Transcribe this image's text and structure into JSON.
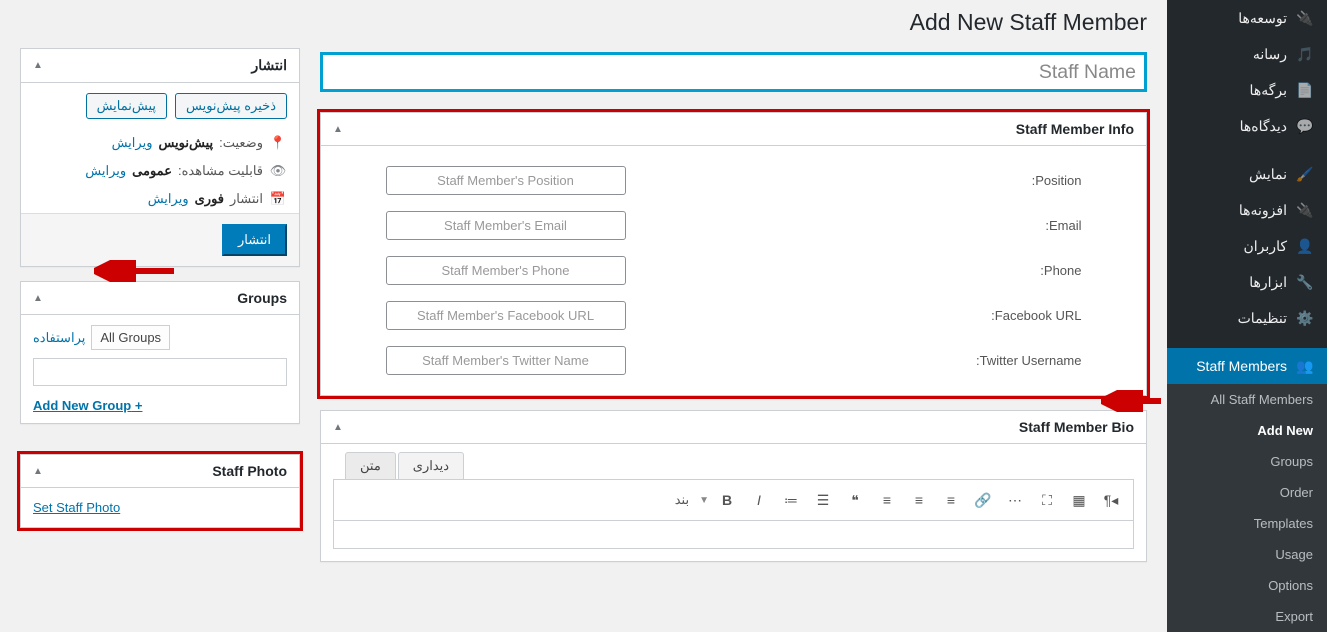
{
  "page": {
    "title": "Add New Staff Member",
    "title_placeholder": "Staff Name"
  },
  "adminmenu": {
    "items": [
      {
        "id": "plugins-top",
        "label": "توسعه‌ها",
        "icon": "plug"
      },
      {
        "id": "media",
        "label": "رسانه",
        "icon": "media"
      },
      {
        "id": "pages",
        "label": "برگه‌ها",
        "icon": "page"
      },
      {
        "id": "comments",
        "label": "دیدگاه‌ها",
        "icon": "comment"
      },
      {
        "id": "appearance",
        "label": "نمایش",
        "icon": "brush"
      },
      {
        "id": "plugins",
        "label": "افزونه‌ها",
        "icon": "plug"
      },
      {
        "id": "users",
        "label": "کاربران",
        "icon": "user"
      },
      {
        "id": "tools",
        "label": "ابزارها",
        "icon": "wrench"
      },
      {
        "id": "settings",
        "label": "تنظیمات",
        "icon": "sliders"
      }
    ],
    "current": {
      "label": "Staff Members",
      "icon": "users"
    },
    "submenu": [
      {
        "id": "all",
        "label": "All Staff Members",
        "active": false
      },
      {
        "id": "add",
        "label": "Add New",
        "active": true
      },
      {
        "id": "groups",
        "label": "Groups",
        "active": false
      },
      {
        "id": "order",
        "label": "Order",
        "active": false
      },
      {
        "id": "templates",
        "label": "Templates",
        "active": false
      },
      {
        "id": "usage",
        "label": "Usage",
        "active": false
      },
      {
        "id": "options",
        "label": "Options",
        "active": false
      },
      {
        "id": "export",
        "label": "Export",
        "active": false
      }
    ]
  },
  "infobox": {
    "title": "Staff Member Info",
    "fields": [
      {
        "label": "Position:",
        "placeholder": "Staff Member's Position"
      },
      {
        "label": "Email:",
        "placeholder": "Staff Member's Email"
      },
      {
        "label": "Phone:",
        "placeholder": "Staff Member's Phone"
      },
      {
        "label": "Facebook URL:",
        "placeholder": "Staff Member's Facebook URL"
      },
      {
        "label": "Twitter Username:",
        "placeholder": "Staff Member's Twitter Name"
      }
    ]
  },
  "biobox": {
    "title": "Staff Member Bio",
    "tabs": {
      "visual": "دیداری",
      "text": "متن"
    },
    "paragraph_label": "بند"
  },
  "publish": {
    "title": "انتشار",
    "save_draft": "ذخیره پیش‌نویس",
    "preview": "پیش‌نمایش",
    "status_label": "وضعیت:",
    "status_value": "پیش‌نویس",
    "status_edit": "ویرایش",
    "visibility_label": "قابلیت مشاهده:",
    "visibility_value": "عمومی",
    "visibility_edit": "ویرایش",
    "publish_label": "انتشار",
    "publish_value": "فوری",
    "publish_edit": "ویرایش",
    "publish_button": "انتشار"
  },
  "groups": {
    "title": "Groups",
    "all_label": "All Groups",
    "used_label": "پراستفاده",
    "add_new": "+ Add New Group"
  },
  "photo": {
    "title": "Staff Photo",
    "set_link": "Set Staff Photo"
  }
}
